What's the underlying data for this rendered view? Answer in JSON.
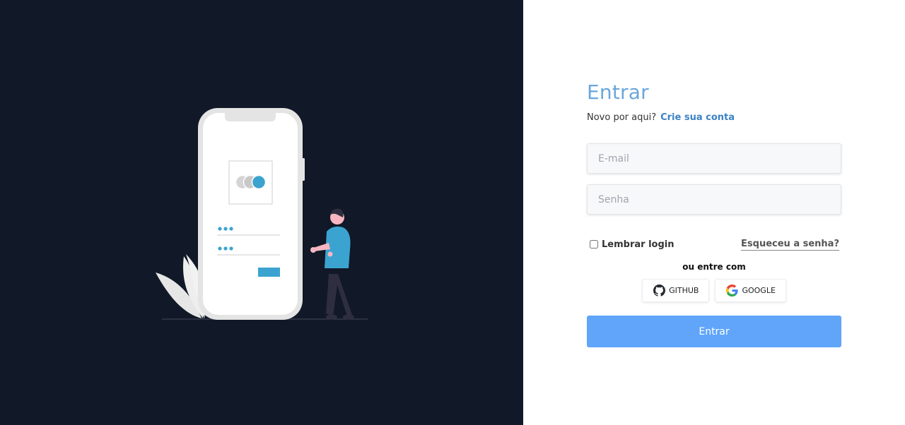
{
  "login": {
    "title": "Entrar",
    "signup_prompt": "Novo por aqui?",
    "signup_link": "Crie sua conta",
    "email_placeholder": "E-mail",
    "password_placeholder": "Senha",
    "remember_label": "Lembrar login",
    "forgot_link": "Esqueceu a senha?",
    "alt_login_text": "ou entre com",
    "github_label": "GITHUB",
    "google_label": "GOOGLE",
    "submit_label": "Entrar"
  },
  "icons": {
    "github": "github-icon",
    "google": "google-icon"
  },
  "colors": {
    "left_panel_bg": "#111827",
    "title": "#6aa7dc",
    "link": "#3b82c4",
    "submit_bg": "#60a5fa",
    "illustration_accent": "#3ba3d0"
  }
}
